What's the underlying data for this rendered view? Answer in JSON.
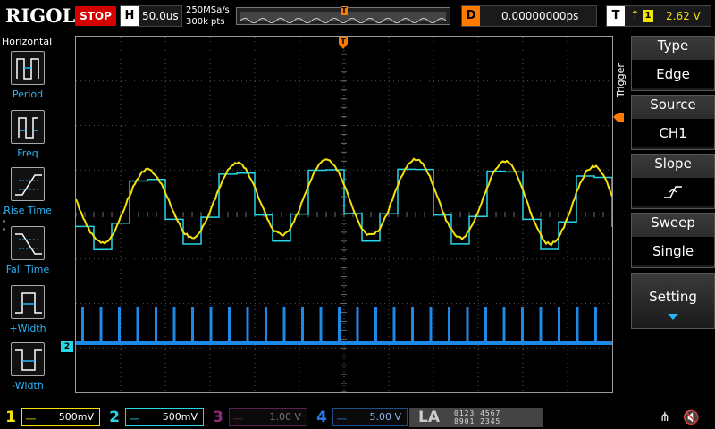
{
  "topbar": {
    "brand": "RIGOL",
    "run_state": "STOP",
    "timebase_key": "H",
    "timebase_value": "50.0us",
    "sample_rate": "250MSa/s",
    "memory_depth": "300k pts",
    "trigger_marker": "T",
    "delay_key": "D",
    "delay_value": "0.00000000ps",
    "trigger_key": "T",
    "trigger_edge_symbol": "↑",
    "trigger_channel": "1",
    "trigger_level": "2.62 V"
  },
  "left_panel": {
    "title": "Horizontal",
    "items": [
      {
        "label": "Period",
        "icon": "period-icon"
      },
      {
        "label": "Freq",
        "icon": "frequency-icon"
      },
      {
        "label": "Rise Time",
        "icon": "rise-time-icon"
      },
      {
        "label": "Fall Time",
        "icon": "fall-time-icon"
      },
      {
        "label": "+Width",
        "icon": "positive-width-icon"
      },
      {
        "label": "-Width",
        "icon": "negative-width-icon"
      }
    ]
  },
  "right_menu": {
    "side_label": "Trigger",
    "items": [
      {
        "header": "Type",
        "value": "Edge"
      },
      {
        "header": "Source",
        "value": "CH1"
      },
      {
        "header": "Slope",
        "value": "rising-edge-icon"
      },
      {
        "header": "Sweep",
        "value": "Single"
      }
    ],
    "setting_label": "Setting"
  },
  "channels": [
    {
      "num": "1",
      "scale": "500mV",
      "color": "#f5e10a",
      "active": true
    },
    {
      "num": "2",
      "scale": "500mV",
      "color": "#27d6e6",
      "active": true
    },
    {
      "num": "3",
      "scale": "1.00 V",
      "color": "#c02fa0",
      "active": false
    },
    {
      "num": "4",
      "scale": "5.00 V",
      "color": "#2a7be4",
      "active": false
    }
  ],
  "la": {
    "label": "LA",
    "row1": "0123 4567",
    "row2": "8901 2345"
  },
  "markers": {
    "ch2_marker": "2"
  },
  "colors": {
    "ch1": "#f5e10a",
    "ch2": "#27d6e6",
    "digital": "#1e88e5",
    "trigger": "#ff7a00",
    "grid": "#6a6a6a"
  }
}
